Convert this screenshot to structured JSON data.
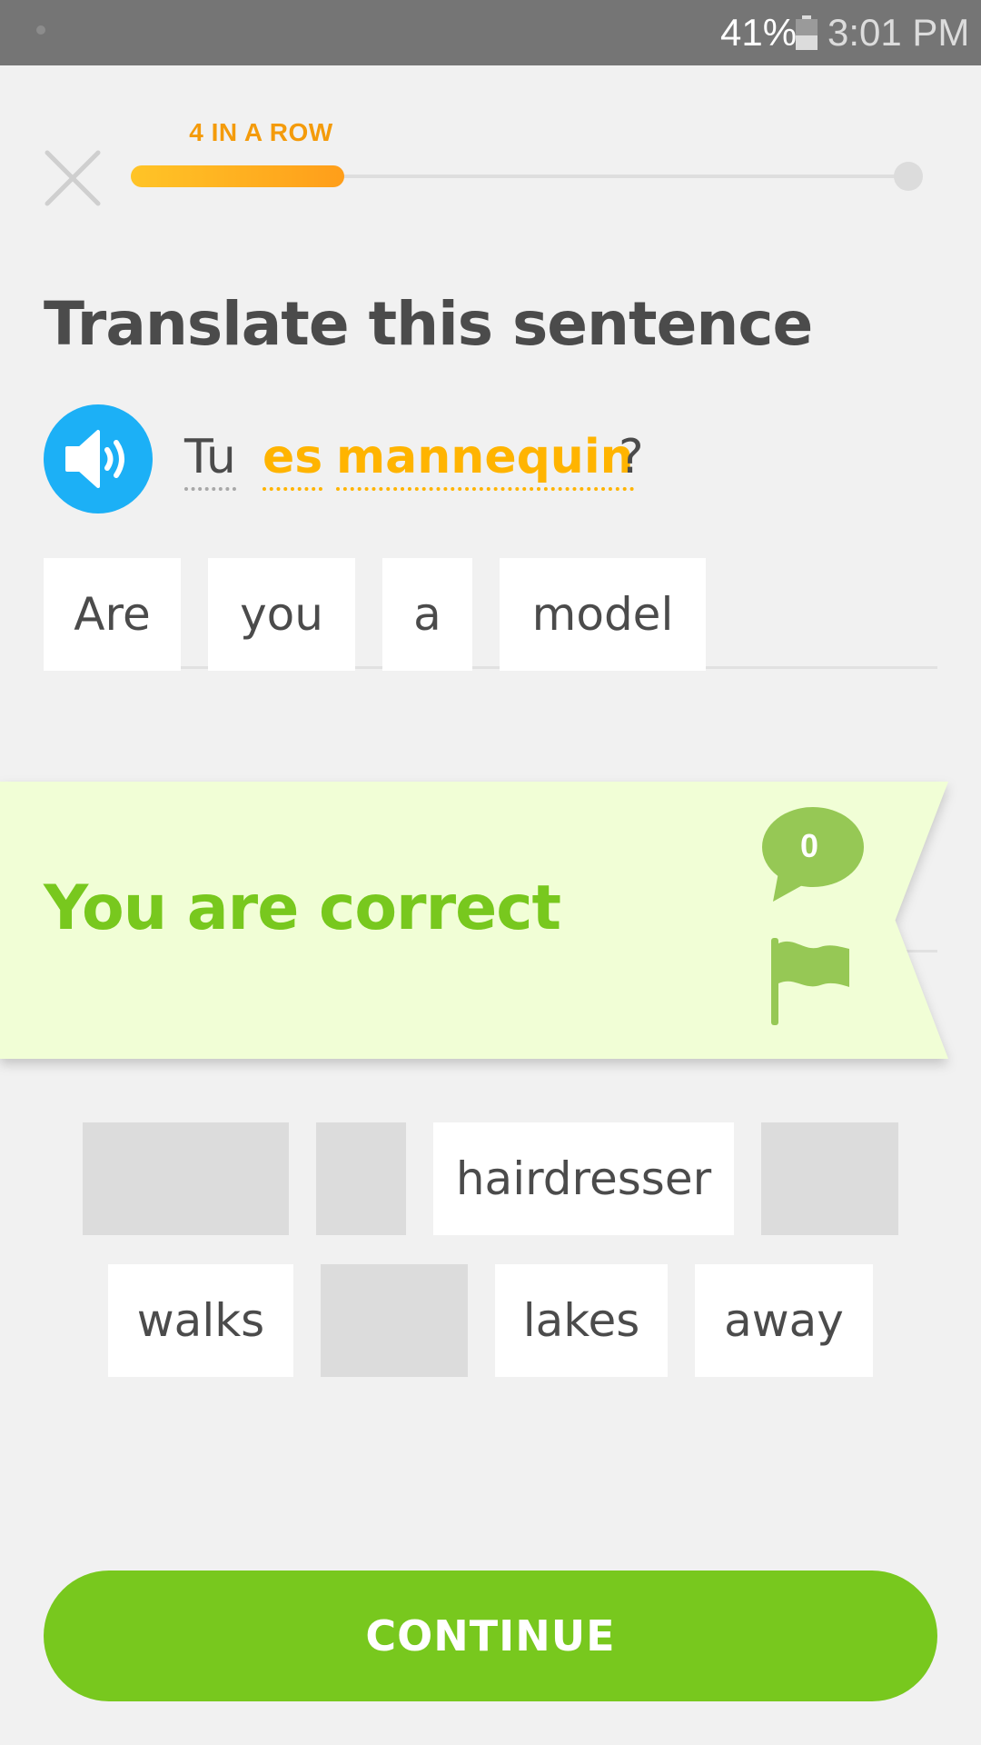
{
  "status_bar": {
    "battery_percent": "41%",
    "time": "3:01 PM"
  },
  "header": {
    "streak_label": "4 IN A ROW",
    "progress_fraction": 0.27
  },
  "title": "Translate this sentence",
  "prompt": {
    "words": [
      "Tu",
      "es",
      "mannequin",
      "?"
    ]
  },
  "answer_tiles": [
    "Are",
    "you",
    "a",
    "model"
  ],
  "feedback": {
    "message": "You are correct",
    "comment_count": "0"
  },
  "word_bank": {
    "row1": [
      "",
      "",
      "hairdresser",
      ""
    ],
    "row2": [
      "walks",
      "",
      "lakes",
      "away"
    ]
  },
  "continue_label": "CONTINUE",
  "colors": {
    "correct_green": "#78c81e",
    "banner_bg": "#f1fed6",
    "speaker_blue": "#1cb0f6",
    "streak_orange": "#f49b0b"
  },
  "icons": {
    "close": "close-icon",
    "speaker": "speaker-icon",
    "comment": "comment-icon",
    "flag": "flag-icon"
  }
}
